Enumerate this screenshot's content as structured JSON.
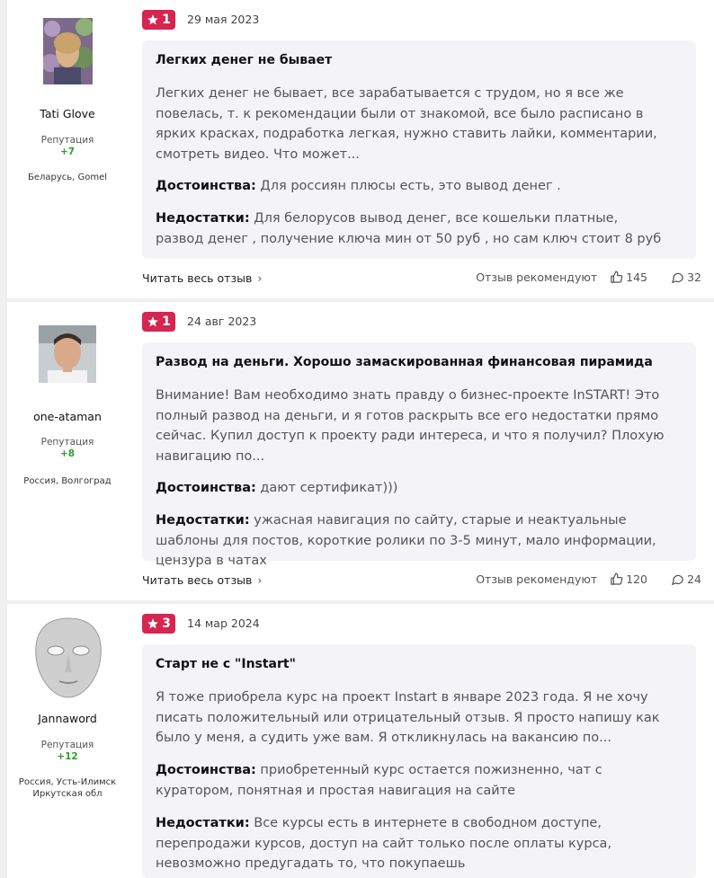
{
  "reviews": [
    {
      "author": "Tati Glove",
      "reputation_label": "Репутация",
      "reputation_value": "+7",
      "location": "Беларусь, Gomel",
      "rating": "1",
      "date": "29 мая 2023",
      "title": "Легких денег не бывает",
      "text": "Легких денег не бывает, все зарабатывается с трудом, но я все же повелась, т. к рекомендации были от знакомой, все было расписано в ярких красках, подработка легкая, нужно ставить лайки, комментарии, смотреть видео. Что может...",
      "pros_label": "Достоинства:",
      "pros": "Для россиян плюсы есть, это вывод денег .",
      "cons_label": "Недостатки:",
      "cons": "Для белорусов вывод денег, все кошельки платные, развод денег , получение ключа мин от 50 руб , но сам ключ стоит 8 руб",
      "read_more": "Читать весь отзыв",
      "recommend_label": "Отзыв рекомендуют",
      "likes": "145",
      "comments": "32"
    },
    {
      "author": "one-ataman",
      "reputation_label": "Репутация",
      "reputation_value": "+8",
      "location": "Россия, Волгоград",
      "rating": "1",
      "date": "24 авг 2023",
      "title": "Развод на деньги. Хорошо замаскированная финансовая пирамида",
      "text": "Внимание! Вам необходимо знать правду о бизнес-проекте InSTART! Это полный развод на деньги, и я готов раскрыть все его недостатки прямо сейчас. Купил доступ к проекту ради интереса, и что я получил? Плохую навигацию по...",
      "pros_label": "Достоинства:",
      "pros": "дают сертификат)))",
      "cons_label": "Недостатки:",
      "cons": "ужасная навигация по сайту, старые и неактуальные шаблоны для постов, короткие ролики по 3-5 минут, мало информации, цензура в чатах",
      "read_more": "Читать весь отзыв",
      "recommend_label": "Отзыв рекомендуют",
      "likes": "120",
      "comments": "24"
    },
    {
      "author": "Jannaword",
      "reputation_label": "Репутация",
      "reputation_value": "+12",
      "location": "Россия, Усть-Илимск Иркутская обл",
      "rating": "3",
      "date": "14 мар 2024",
      "title": "Старт не с \"Instart\"",
      "text": "Я тоже приобрела курс на проект Instart в январе 2023 года. Я не хочу писать положительный или отрицательный отзыв. Я просто напишу как было у меня, а судить уже вам. Я откликнулась на вакансию по...",
      "pros_label": "Достоинства:",
      "pros": "приобретенный курс остается пожизненно, чат с куратором, понятная и простая навигация на сайте",
      "cons_label": "Недостатки:",
      "cons": "Все курсы есть в интернете в свободном доступе, перепродажи курсов, доступ на сайт только после оплаты курса, невозможно предугадать то, что покупаешь"
    }
  ],
  "colors": {
    "rating_badge": "#d6254f",
    "reputation": "#2e9e2e",
    "card_bg": "#f4f4f6"
  }
}
